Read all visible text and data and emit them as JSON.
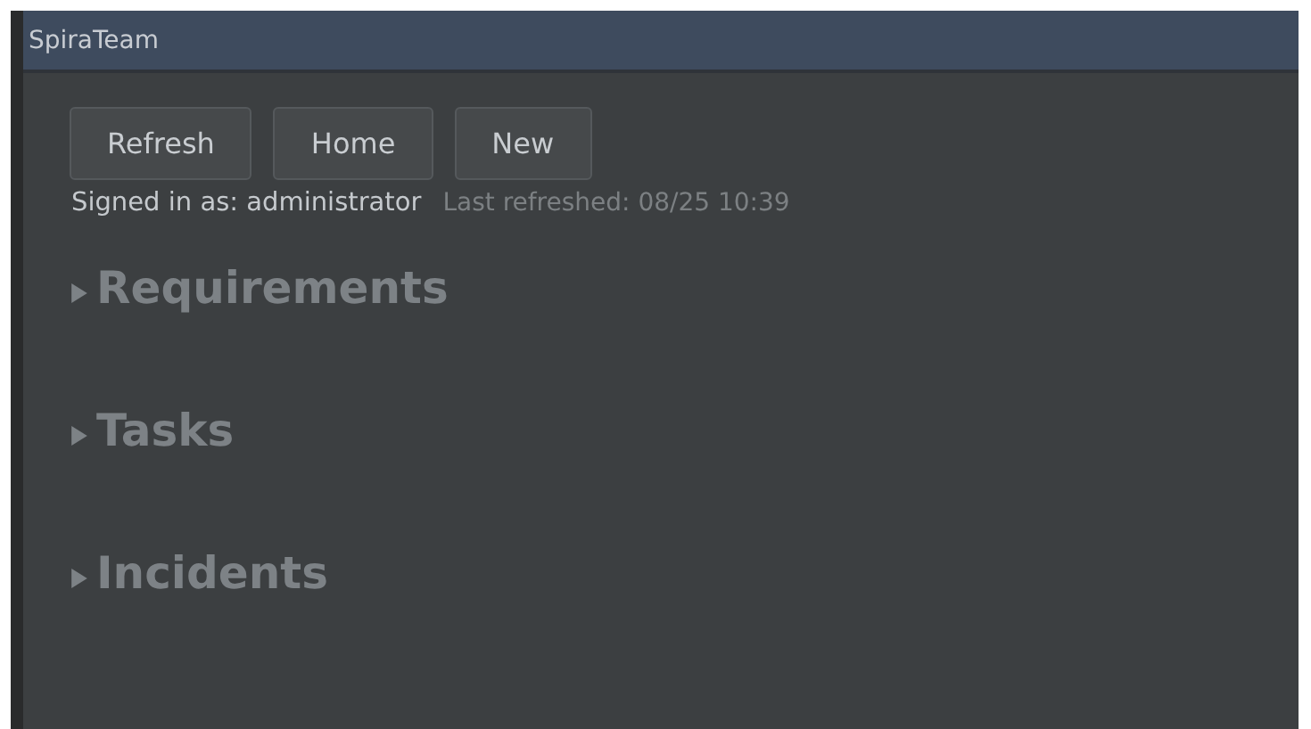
{
  "window": {
    "title": "SpiraTeam"
  },
  "buttons": [
    "Refresh",
    "Home",
    "New"
  ],
  "status": {
    "signed_in": "Signed in as: administrator",
    "last_refreshed": "Last refreshed: 08/25 10:39"
  },
  "sections": [
    {
      "title": "Requirements",
      "expanded": false
    },
    {
      "title": "Tasks",
      "expanded": false
    },
    {
      "title": "Incidents",
      "expanded": false
    }
  ]
}
